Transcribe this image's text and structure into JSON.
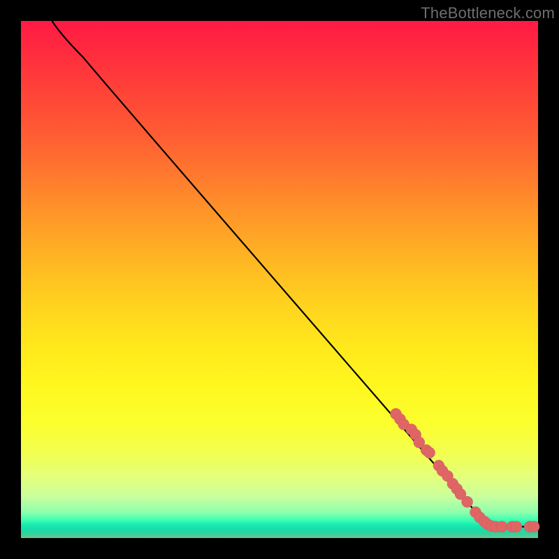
{
  "watermark": "TheBottleneck.com",
  "chart_data": {
    "type": "line",
    "title": "",
    "xlabel": "",
    "ylabel": "",
    "xlim": [
      0,
      100
    ],
    "ylim": [
      0,
      100
    ],
    "curve": [
      {
        "x": 6,
        "y": 100
      },
      {
        "x": 8,
        "y": 97
      },
      {
        "x": 12,
        "y": 93
      },
      {
        "x": 17,
        "y": 87
      },
      {
        "x": 88,
        "y": 5
      },
      {
        "x": 90,
        "y": 3
      },
      {
        "x": 92,
        "y": 2.2
      },
      {
        "x": 100,
        "y": 2.2
      }
    ],
    "points": [
      {
        "x": 72.5,
        "y": 24.0
      },
      {
        "x": 73.3,
        "y": 23.0
      },
      {
        "x": 74.0,
        "y": 22.0
      },
      {
        "x": 75.5,
        "y": 21.0
      },
      {
        "x": 76.3,
        "y": 20.0
      },
      {
        "x": 77.0,
        "y": 18.5
      },
      {
        "x": 78.4,
        "y": 17.0
      },
      {
        "x": 79.0,
        "y": 16.5
      },
      {
        "x": 80.8,
        "y": 14.0
      },
      {
        "x": 81.5,
        "y": 13.0
      },
      {
        "x": 82.5,
        "y": 12.0
      },
      {
        "x": 83.5,
        "y": 10.5
      },
      {
        "x": 84.3,
        "y": 9.5
      },
      {
        "x": 85.0,
        "y": 8.5
      },
      {
        "x": 86.3,
        "y": 7.0
      },
      {
        "x": 87.9,
        "y": 5.0
      },
      {
        "x": 88.7,
        "y": 4.0
      },
      {
        "x": 89.6,
        "y": 3.2
      },
      {
        "x": 90.2,
        "y": 2.7
      },
      {
        "x": 91.0,
        "y": 2.3
      },
      {
        "x": 91.8,
        "y": 2.2
      },
      {
        "x": 93.0,
        "y": 2.2
      },
      {
        "x": 95.0,
        "y": 2.2
      },
      {
        "x": 95.8,
        "y": 2.2
      },
      {
        "x": 98.4,
        "y": 2.2
      },
      {
        "x": 99.2,
        "y": 2.2
      }
    ],
    "point_radius_px": 8,
    "gradient_top_color": "#ff1a44",
    "gradient_bottom_color": "#75c38e"
  }
}
